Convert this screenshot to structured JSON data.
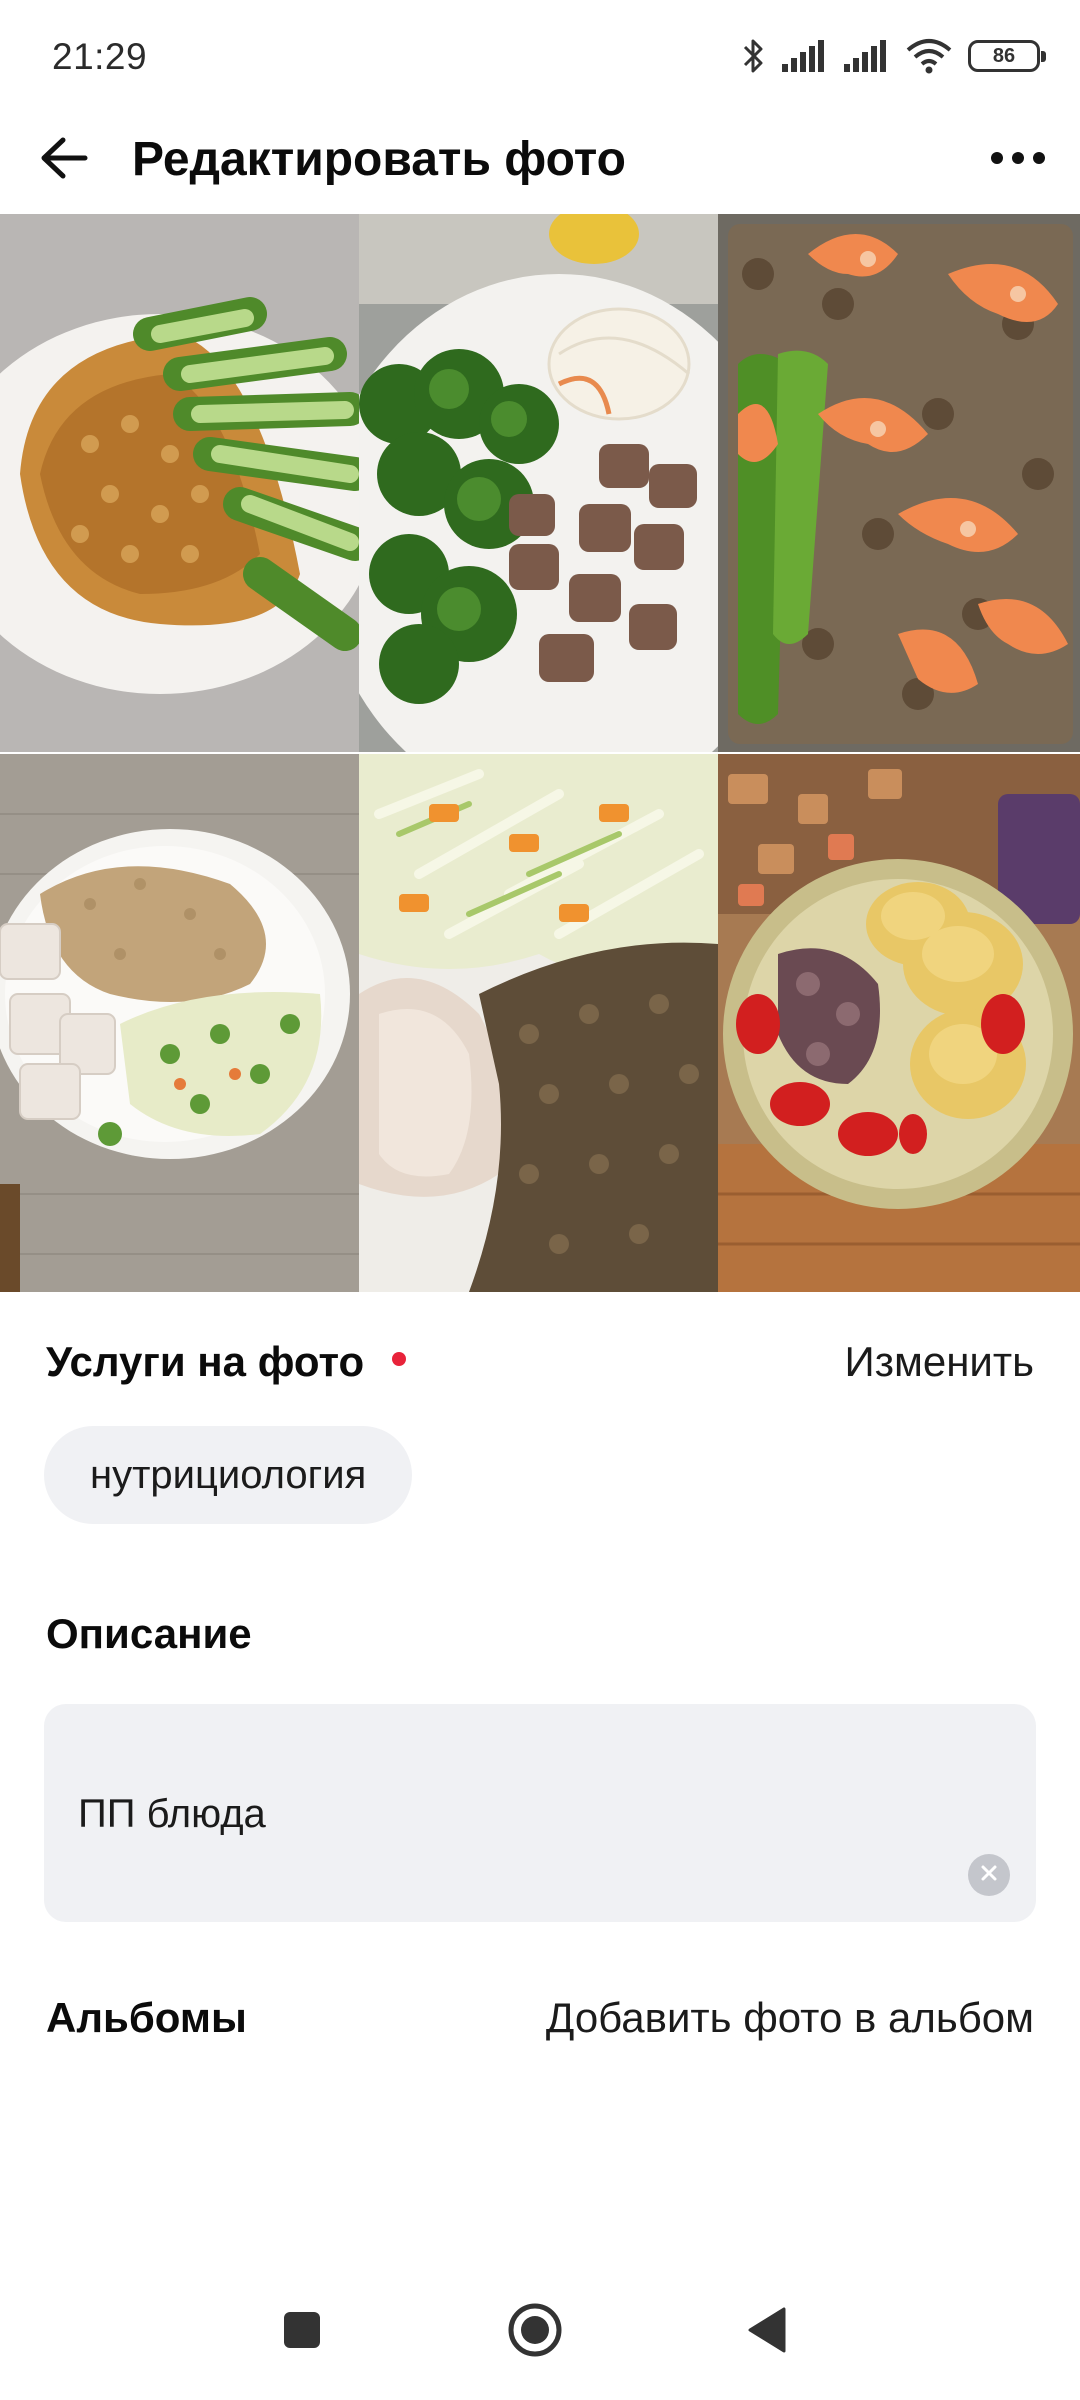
{
  "status_bar": {
    "time": "21:29",
    "battery": "86",
    "icons": [
      "bluetooth-icon",
      "signal-icon",
      "signal-icon",
      "wifi-icon",
      "battery-icon"
    ]
  },
  "header": {
    "title": "Редактировать фото",
    "back_icon": "arrow-left-icon",
    "menu_icon": "more-horizontal-icon"
  },
  "photos": [
    {
      "subject": "omelette with cucumbers"
    },
    {
      "subject": "broccoli, meat and cabbage"
    },
    {
      "subject": "buckwheat with shrimp and cucumber"
    },
    {
      "subject": "bulgur with chicken and salad"
    },
    {
      "subject": "cabbage salad, chicken and buckwheat"
    },
    {
      "subject": "potatoes, tomatoes and fish"
    }
  ],
  "services": {
    "title": "Услуги на фото",
    "change_label": "Изменить",
    "selected": [
      "нутрициология"
    ]
  },
  "description": {
    "title": "Описание",
    "value": "ПП блюда",
    "clear_icon": "clear-circle-icon"
  },
  "albums": {
    "title": "Альбомы",
    "add_label": "Добавить фото в альбом"
  },
  "nav_bar": {
    "icons": [
      "recents-square-icon",
      "home-circle-icon",
      "back-triangle-icon"
    ]
  },
  "colors": {
    "required_dot": "#e8233a",
    "chip_bg": "#f0f1f4",
    "field_bg": "#f0f1f4"
  }
}
